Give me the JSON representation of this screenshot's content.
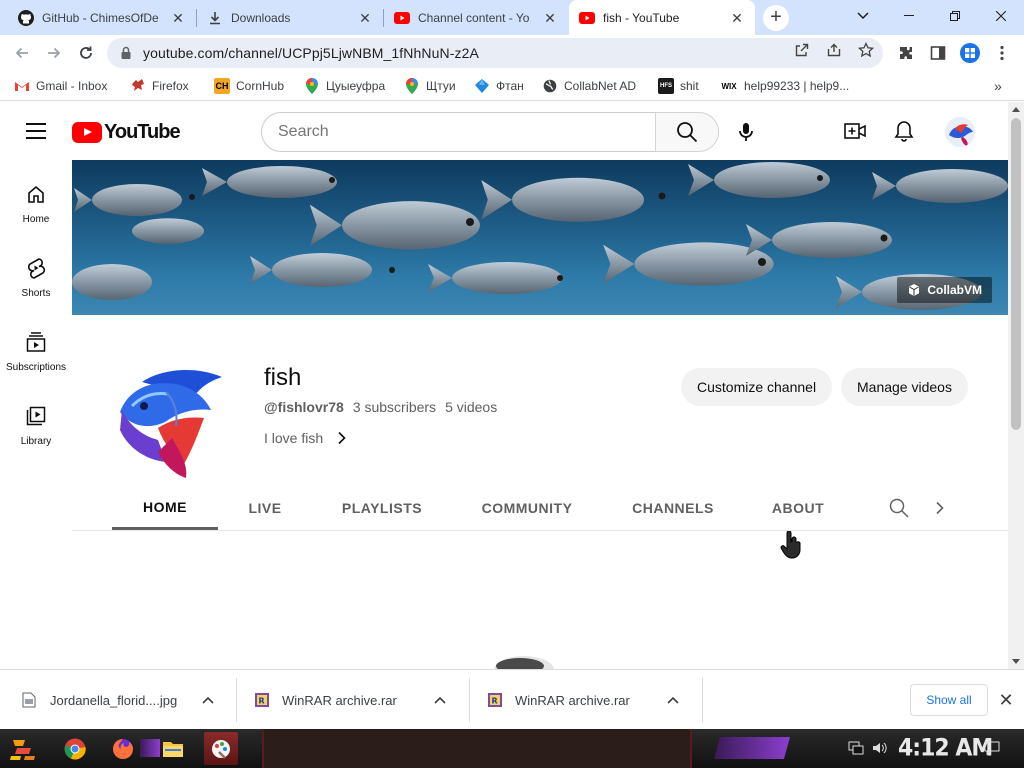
{
  "browser": {
    "tabs": [
      {
        "title": "GitHub - ChimesOfDe",
        "icon": "github-icon"
      },
      {
        "title": "Downloads",
        "icon": "download-icon"
      },
      {
        "title": "Channel content - Yo",
        "icon": "youtube-studio-icon"
      },
      {
        "title": "fish - YouTube",
        "icon": "youtube-icon",
        "active": true
      }
    ],
    "url": "youtube.com/channel/UCPpj5LjwNBM_1fNhNuN-z2A",
    "bookmarks": [
      {
        "label": "Gmail - Inbox",
        "icon": "gmail-icon"
      },
      {
        "label": "Firefox",
        "icon": "firefox-icon"
      },
      {
        "label": "CornHub",
        "icon": "ch-icon"
      },
      {
        "label": "Цуыеуфра",
        "icon": "maps-pin-icon"
      },
      {
        "label": "Щтуи",
        "icon": "maps-pin-icon"
      },
      {
        "label": "Фтан",
        "icon": "diamond-icon"
      },
      {
        "label": "CollabNet AD",
        "icon": "globe-icon"
      },
      {
        "label": "shit",
        "icon": "hfs-icon"
      },
      {
        "label": "help99233 | help9...",
        "icon": "wix-icon"
      }
    ],
    "more_bookmarks": "»"
  },
  "youtube": {
    "logo_text": "YouTube",
    "search_placeholder": "Search",
    "rail": [
      {
        "label": "Home",
        "icon": "home-icon"
      },
      {
        "label": "Shorts",
        "icon": "shorts-icon"
      },
      {
        "label": "Subscriptions",
        "icon": "subscriptions-icon"
      },
      {
        "label": "Library",
        "icon": "library-icon"
      }
    ],
    "banner_link": "CollabVM",
    "channel": {
      "name": "fish",
      "handle": "@fishlovr78",
      "subscribers": "3 subscribers",
      "videos": "5 videos",
      "description": "I love fish",
      "customize_label": "Customize channel",
      "manage_label": "Manage videos"
    },
    "tabs": [
      "HOME",
      "LIVE",
      "PLAYLISTS",
      "COMMUNITY",
      "CHANNELS",
      "ABOUT"
    ],
    "active_tab": "HOME"
  },
  "downloads": {
    "items": [
      {
        "name": "Jordanella_florid....jpg",
        "icon": "image-file-icon"
      },
      {
        "name": "WinRAR archive.rar",
        "icon": "winrar-icon"
      },
      {
        "name": "WinRAR archive.rar",
        "icon": "winrar-icon"
      }
    ],
    "show_all": "Show all"
  },
  "taskbar": {
    "clock": "4:12 AM"
  },
  "colors": {
    "youtube_red": "#ff0000",
    "chrome_tabstrip": "#d3e3fd",
    "omnibox_bg": "#e9eef6"
  }
}
